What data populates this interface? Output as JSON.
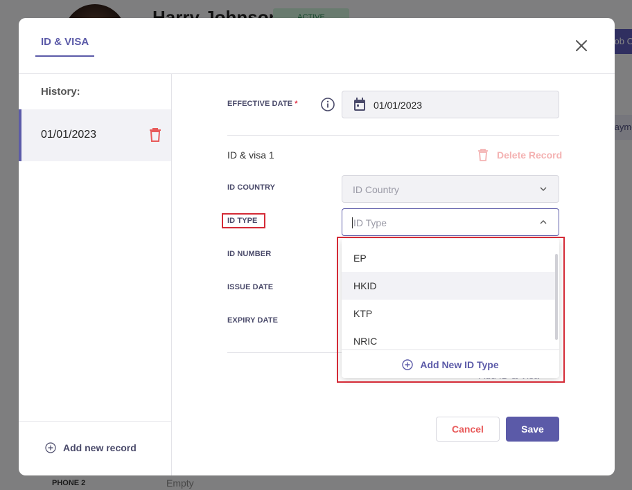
{
  "background": {
    "name": "Harry Johnson",
    "status_badge": "ACTIVE",
    "job_button": "Job C",
    "pay_tab": "Payme",
    "phone_label": "PHONE 2",
    "phone_value": "Empty"
  },
  "modal": {
    "tab": "ID & VISA",
    "close_icon": "close-icon"
  },
  "sidebar": {
    "history_label": "History:",
    "items": [
      {
        "date": "01/01/2023",
        "icon": "trash-icon"
      }
    ],
    "add_new_record": "Add new record"
  },
  "form": {
    "effective_date_label": "EFFECTIVE DATE",
    "required_mark": "*",
    "effective_date_value": "01/01/2023",
    "record_title": "ID & visa 1",
    "delete_record": "Delete Record",
    "id_country_label": "ID COUNTRY",
    "id_country_placeholder": "ID Country",
    "id_type_label": "ID TYPE",
    "id_type_placeholder": "ID Type",
    "id_number_label": "ID NUMBER",
    "issue_date_label": "ISSUE DATE",
    "expiry_date_label": "EXPIRY DATE",
    "add_id_visa": "Add ID & Visa"
  },
  "dropdown": {
    "options": [
      "EP",
      "HKID",
      "KTP",
      "NRIC"
    ],
    "hovered": "HKID",
    "add_new": "Add New ID Type"
  },
  "buttons": {
    "cancel": "Cancel",
    "save": "Save"
  },
  "colors": {
    "accent": "#5b5aa8",
    "danger": "#e85a5a",
    "highlight_box": "#d42a36"
  }
}
